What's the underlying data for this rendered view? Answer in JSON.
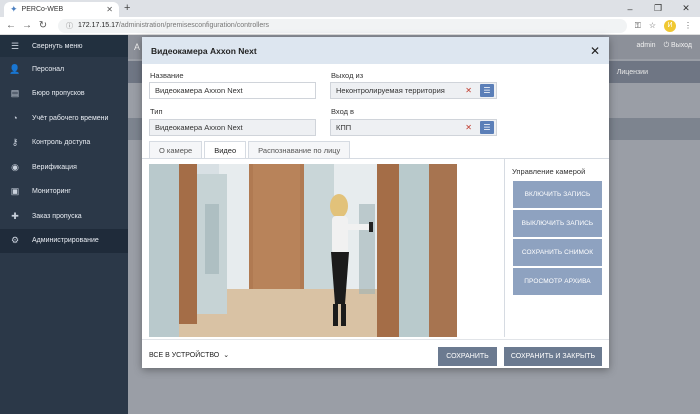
{
  "browser": {
    "tab_title": "PERCo-WEB",
    "address_host": "172.17.15.17",
    "address_path": "/administration/premisesconfiguration/controllers",
    "avatar_letter": "И"
  },
  "app": {
    "title_partial": "А",
    "user": "admin",
    "logout": "Выход",
    "licenses": "Лицензии"
  },
  "sidebar": {
    "collapse_label": "Свернуть меню",
    "items": [
      {
        "label": "Персонал",
        "icon": "person-icon"
      },
      {
        "label": "Бюро пропусков",
        "icon": "badge-icon"
      },
      {
        "label": "Учёт рабочего времени",
        "icon": "clock-icon"
      },
      {
        "label": "Контроль доступа",
        "icon": "key-icon"
      },
      {
        "label": "Верификация",
        "icon": "fingerprint-icon"
      },
      {
        "label": "Мониторинг",
        "icon": "monitor-icon"
      },
      {
        "label": "Заказ пропуска",
        "icon": "add-person-icon"
      },
      {
        "label": "Администрирование",
        "icon": "gear-icon",
        "active": true
      }
    ]
  },
  "modal": {
    "title": "Видеокамера Axxon Next",
    "name_label": "Название",
    "name_value": "Видеокамера Axxon Next",
    "exit_label": "Выход из",
    "exit_value": "Неконтролируемая территория",
    "type_label": "Тип",
    "type_value": "Видеокамера Axxon Next",
    "entry_label": "Вход в",
    "entry_value": "КПП",
    "tabs": [
      "О камере",
      "Видео",
      "Распознавание по лицу"
    ],
    "active_tab": 1,
    "camera_control_title": "Управление камерой",
    "camera_buttons": [
      "ВКЛЮЧИТЬ ЗАПИСЬ",
      "ВЫКЛЮЧИТЬ ЗАПИСЬ",
      "СОХРАНИТЬ СНИМОК",
      "ПРОСМОТР АРХИВА"
    ],
    "device_dropdown": "ВСЕ В УСТРОЙСТВО",
    "save": "СОХРАНИТЬ",
    "save_close": "СОХРАНИТЬ И ЗАКРЫТЬ"
  },
  "colors": {
    "sidebar_bg": "#2b3848",
    "modal_header": "#dde6f0",
    "button_bg": "#6b7a90",
    "camera_button_bg": "#8ea2c0",
    "list_button": "#5b7fb8"
  }
}
